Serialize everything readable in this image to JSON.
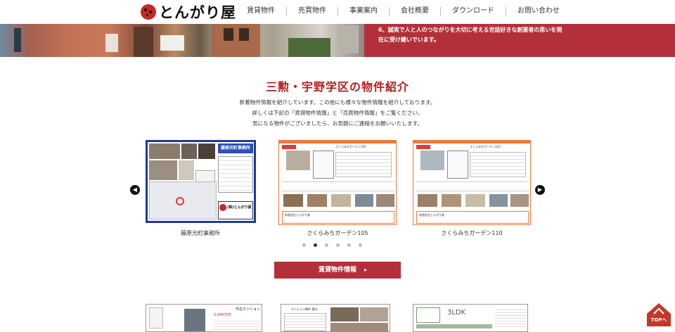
{
  "header": {
    "logo_text": "とんがり屋",
    "nav": [
      {
        "label": "賃貸物件"
      },
      {
        "label": "売買物件"
      },
      {
        "label": "事業案内"
      },
      {
        "label": "会社概要"
      },
      {
        "label": "ダウンロード"
      },
      {
        "label": "お問い合わせ"
      }
    ]
  },
  "hero": {
    "text_line1": "6、誠実で人と人のつながりを大切に考える世話好きな創業者の思いを現",
    "text_line2": "在に受け継いでいます。"
  },
  "section": {
    "title": "三勲・宇野学区の物件紹介",
    "intro_lines": [
      "新着物件情報を紹介しています。この他にも様々な物件情報を紹介しております。",
      "詳しくは下記の「賃貸物件情報」と「売買物件情報」をご覧ください。",
      "気になる物件がございましたら、お気軽にご連絡をお願いいたします。"
    ]
  },
  "carousel": {
    "items": [
      {
        "caption": "藤原光町事務所",
        "flyer_heading": "藤原光町事務所",
        "flyer_brand": "(株)とんがり屋"
      },
      {
        "caption": "さくらみちガーデン105",
        "flyer_heading": "さくらみちガーデン105",
        "flyer_footer": "有限会社とんがり屋"
      },
      {
        "caption": "さくらみちガーデン110",
        "flyer_heading": "さくらみちガーデン110",
        "flyer_footer": "有限会社とんがり屋"
      }
    ],
    "dots_count": 6,
    "active_dot": 1,
    "prev_icon": "chevron-left-icon",
    "next_icon": "chevron-right-icon"
  },
  "cta": {
    "label": "賃貸物件情報"
  },
  "bottom_cards": [
    {
      "heading": "中古マンション",
      "price": "2,000万円"
    },
    {
      "heading": "マンション物件 案内"
    },
    {
      "heading": "3LDK"
    }
  ],
  "top_button": {
    "label": "TOPへ"
  },
  "colors": {
    "brand": "#b3303a",
    "title": "#b71c1c",
    "flyer_border": "#f07a3a",
    "flyer_blue": "#1e3a9c"
  }
}
